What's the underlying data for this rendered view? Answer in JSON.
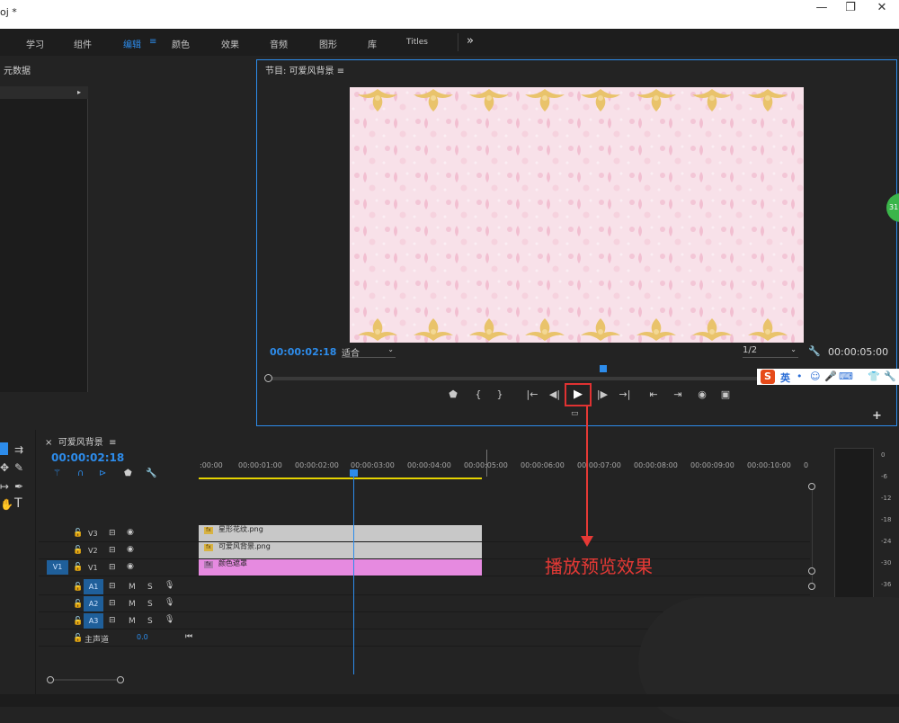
{
  "window": {
    "title": "oj *",
    "controls": [
      "—",
      "❐",
      "✕"
    ]
  },
  "workspaces": [
    "学习",
    "组件",
    "编辑",
    "颜色",
    "效果",
    "音频",
    "图形",
    "库",
    "Titles"
  ],
  "workspace_active": "编辑",
  "workspace_menu_icon": "≡",
  "more_icon": "»",
  "metadata_panel": {
    "title": "元数据",
    "arrow": "▸"
  },
  "program_monitor": {
    "title": "节目: 可爱风背景",
    "menu_icon": "≡",
    "timecode_current": "00:00:02:18",
    "fit_value": "适合",
    "resolution_value": "1/2",
    "timecode_duration": "00:00:05:00",
    "wrench": "🔧",
    "add": "+",
    "controls": {
      "mark_in": "⬟",
      "brace_in": "{",
      "brace_out": "}",
      "go_in": "|←",
      "step_back": "◀|",
      "play": "▶",
      "step_fwd": "|▶",
      "go_out": "→|",
      "lift": "⇤",
      "extract": "⇥",
      "export_frame": "◉",
      "compare": "▣"
    }
  },
  "ime": {
    "logo": "S",
    "lang": "英",
    "icons": [
      "•",
      "☺",
      "🎤",
      "⌨",
      "👕",
      "🔧"
    ]
  },
  "side_badge": "31",
  "timeline": {
    "close": "×",
    "title": "可爱风背景",
    "menu_icon": "≡",
    "timecode": "00:00:02:18",
    "ruler_labels": [
      ":00:00",
      "00:00:01:00",
      "00:00:02:00",
      "00:00:03:00",
      "00:00:04:00",
      "00:00:05:00",
      "00:00:06:00",
      "00:00:07:00",
      "00:00:08:00",
      "00:00:09:00",
      "00:00:10:00",
      "0"
    ],
    "video_tracks": [
      {
        "name": "V3",
        "clip": "星形花纹.png"
      },
      {
        "name": "V2",
        "clip": "可爱风背景.png"
      },
      {
        "name": "V1",
        "clip": "颜色遮罩"
      }
    ],
    "source_patch": "V1",
    "audio_tracks": [
      "A1",
      "A2",
      "A3"
    ],
    "track_buttons": {
      "mute": "M",
      "solo": "S"
    },
    "master": {
      "label": "主声道",
      "value": "0.0"
    },
    "fx_badge": "fx",
    "master_icon": "⏮"
  },
  "audio_meter": {
    "labels": [
      "0",
      "-6",
      "-12",
      "-18",
      "-24",
      "-30",
      "-36"
    ]
  },
  "annotation": "播放预览效果",
  "colors": {
    "accent": "#2d8ceb",
    "annotation": "#e53935",
    "work_area": "#e5d300",
    "matte_clip": "#e68ae0",
    "png_clip": "#c8c8c8"
  }
}
